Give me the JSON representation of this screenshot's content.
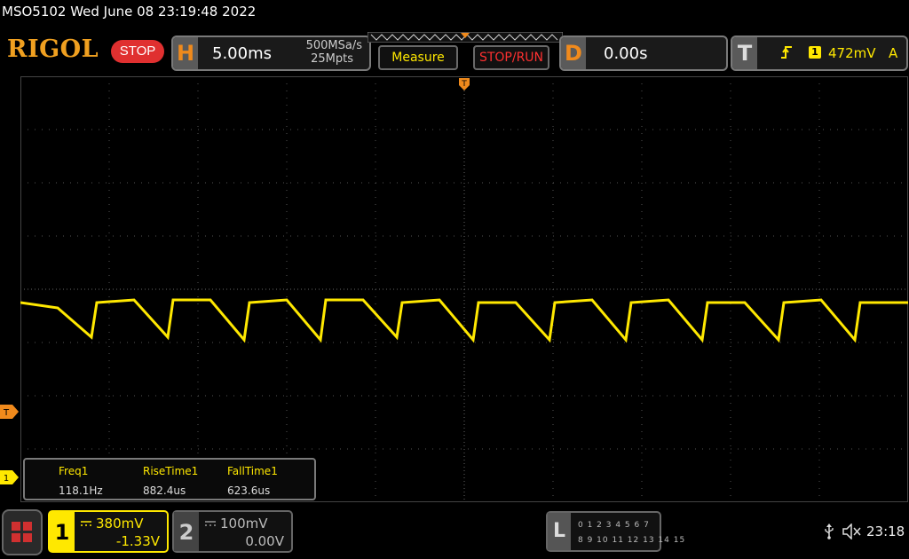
{
  "header": {
    "model_datetime": "MSO5102  Wed June 08 23:19:48 2022",
    "brand": "RIGOL",
    "run_state": "STOP"
  },
  "horizontal": {
    "letter": "H",
    "timebase": "5.00ms",
    "sample_rate": "500MSa/s",
    "memory_depth": "25Mpts"
  },
  "buttons": {
    "measure": "Measure",
    "stop_run": "STOP/RUN"
  },
  "delay": {
    "letter": "D",
    "value": "0.00s"
  },
  "trigger": {
    "letter": "T",
    "source": "1",
    "level": "472mV",
    "mode": "A",
    "marker_label": "T"
  },
  "measurements": [
    {
      "label": "Freq1",
      "value": "118.1Hz"
    },
    {
      "label": "RiseTime1",
      "value": "882.4us"
    },
    {
      "label": "FallTime1",
      "value": "623.6us"
    }
  ],
  "channels": [
    {
      "number": "1",
      "scale": "380mV",
      "offset": "-1.33V",
      "active": true,
      "color": "#ffe800"
    },
    {
      "number": "2",
      "scale": "100mV",
      "offset": "0.00V",
      "active": false,
      "color": "#cccccc"
    }
  ],
  "logic_analyzer": {
    "letter": "L",
    "row1": "0 1 2 3  4 5 6 7",
    "row2": "8 9 10 11 12 13 14 15"
  },
  "status": {
    "clock": "23:18",
    "icons": [
      "usb-icon",
      "mute-icon"
    ]
  },
  "colors": {
    "trace": "#ffe800",
    "accent_orange": "#f08a1c",
    "stop_red": "#e03030"
  },
  "chart_data": {
    "type": "line",
    "title": "",
    "xlabel": "",
    "ylabel": "",
    "xlim": [
      -25,
      25
    ],
    "ylim": [
      -4,
      4
    ],
    "grid": true,
    "x_unit": "ms",
    "y_unit": "div",
    "series": [
      {
        "x": [
          -25,
          -22.9,
          -21.0,
          -20.7,
          -18.6,
          -16.7,
          -16.4,
          -14.3,
          -12.4,
          -12.1,
          -10.0,
          -8.1,
          -7.8,
          -5.7,
          -3.8,
          -3.5,
          -1.4,
          0.5,
          0.8,
          2.9,
          4.8,
          5.1,
          7.2,
          9.1,
          9.4,
          11.5,
          13.4,
          13.7,
          15.8,
          17.7,
          18.0,
          20.1,
          22.0,
          22.3,
          25
        ],
        "values": [
          -0.25,
          -0.35,
          -0.9,
          -0.25,
          -0.2,
          -0.9,
          -0.2,
          -0.2,
          -0.95,
          -0.25,
          -0.2,
          -0.95,
          -0.2,
          -0.2,
          -0.9,
          -0.25,
          -0.2,
          -0.95,
          -0.25,
          -0.25,
          -0.95,
          -0.25,
          -0.2,
          -0.95,
          -0.25,
          -0.2,
          -0.95,
          -0.25,
          -0.25,
          -0.95,
          -0.25,
          -0.2,
          -0.95,
          -0.25,
          -0.25
        ]
      }
    ]
  }
}
